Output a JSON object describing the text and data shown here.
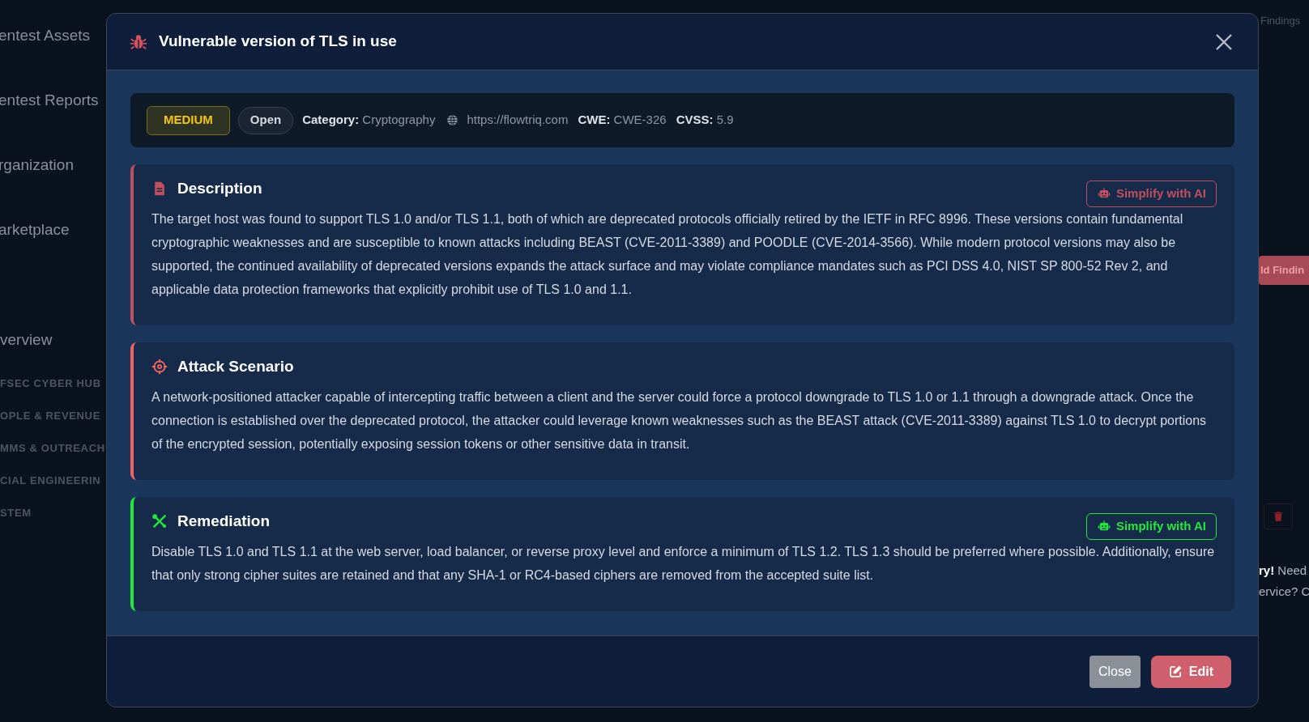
{
  "sidebar": {
    "items": [
      {
        "label": "entest Assets",
        "kind": "nav"
      },
      {
        "label": "entest Reports",
        "kind": "nav"
      },
      {
        "label": "rganization",
        "kind": "nav"
      },
      {
        "label": "arketplace",
        "kind": "nav"
      },
      {
        "label": "verview",
        "kind": "heading"
      },
      {
        "label": "FSEC CYBER HUB",
        "kind": "group"
      },
      {
        "label": "OPLE & REVENUE",
        "kind": "group"
      },
      {
        "label": "MMS & OUTREACH",
        "kind": "group"
      },
      {
        "label": "CIAL ENGINEERIN",
        "kind": "group"
      },
      {
        "label": "STEM",
        "kind": "group"
      }
    ]
  },
  "background": {
    "top_label": "Findings",
    "add_button": "ld Findin",
    "notice_bold": "ry!",
    "notice_lines": [
      " Need",
      "ervice? C"
    ]
  },
  "modal": {
    "title": "Vulnerable version of TLS in use",
    "severity": "MEDIUM",
    "status": "Open",
    "meta": [
      {
        "kind": "field",
        "label": "Category:",
        "value": "Cryptography"
      },
      {
        "kind": "url",
        "value": "https://flowtriq.com"
      },
      {
        "kind": "field",
        "label": "CWE:",
        "value": "CWE-326"
      },
      {
        "kind": "field",
        "label": "CVSS:",
        "value": "5.9"
      }
    ],
    "sections": [
      {
        "kind": "description",
        "title": "Description",
        "color": "#c0505f",
        "ai_button": "Simplify with AI",
        "text": "The target host was found to support TLS 1.0 and/or TLS 1.1, both of which are deprecated protocols officially retired by the IETF in RFC 8996. These versions contain fundamental cryptographic weaknesses and are susceptible to known attacks including BEAST (CVE-2011-3389) and POODLE (CVE-2014-3566). While modern protocol versions may also be supported, the continued availability of deprecated versions expands the attack surface and may violate compliance mandates such as PCI DSS 4.0, NIST SP 800-52 Rev 2, and applicable data protection frameworks that explicitly prohibit use of TLS 1.0 and 1.1."
      },
      {
        "kind": "attack",
        "title": "Attack Scenario",
        "color": "#f06464",
        "text": "A network-positioned attacker capable of intercepting traffic between a client and the server could force a protocol downgrade to TLS 1.0 or 1.1 through a downgrade attack. Once the connection is established over the deprecated protocol, the attacker could leverage known weaknesses such as the BEAST attack (CVE-2011-3389) against TLS 1.0 to decrypt portions of the encrypted session, potentially exposing session tokens or other sensitive data in transit."
      },
      {
        "kind": "remediation",
        "title": "Remediation",
        "color": "#22e83c",
        "ai_button": "Simplify with AI",
        "text": "Disable TLS 1.0 and TLS 1.1 at the web server, load balancer, or reverse proxy level and enforce a minimum of TLS 1.2. TLS 1.3 should be preferred where possible. Additionally, ensure that only strong cipher suites are retained and that any SHA-1 or RC4-based ciphers are removed from the accepted suite list."
      }
    ],
    "buttons": [
      {
        "kind": "secondary",
        "label": "Close"
      },
      {
        "kind": "primary",
        "label": "Edit"
      }
    ]
  }
}
